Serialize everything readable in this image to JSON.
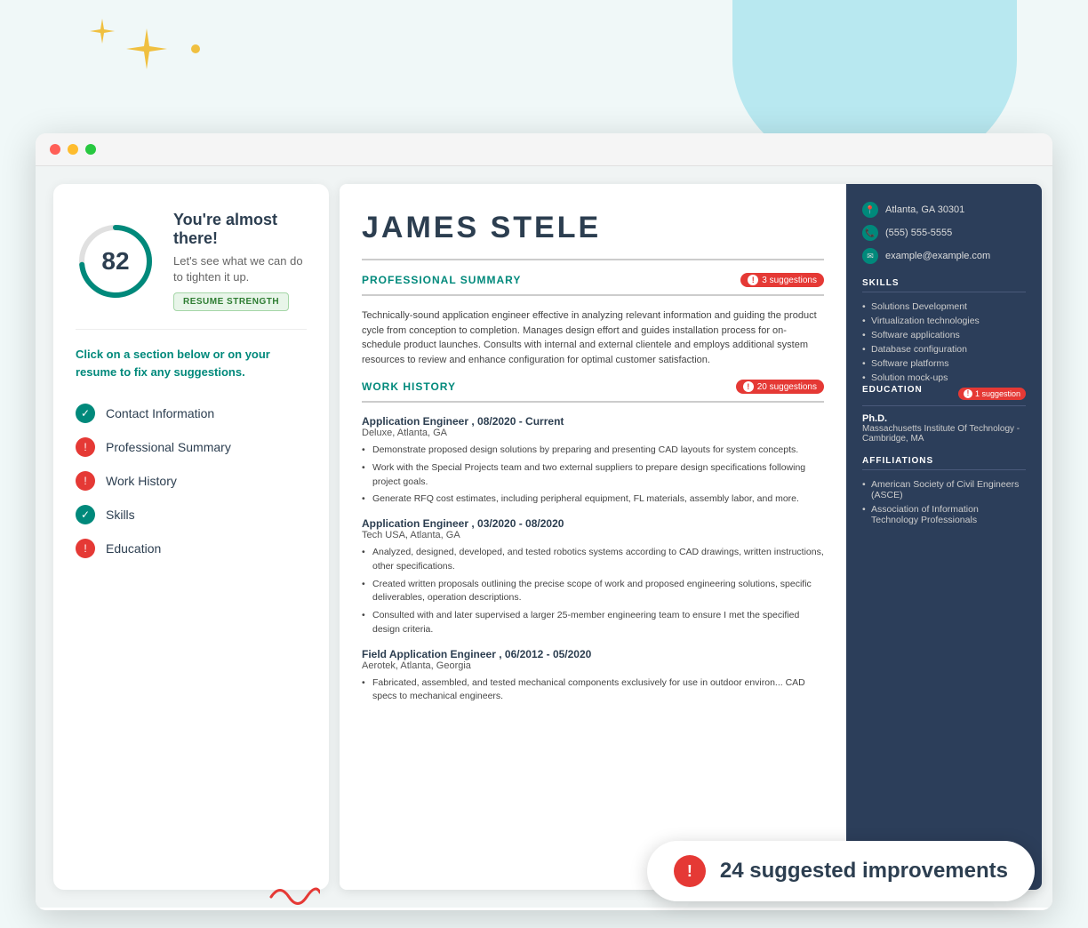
{
  "decorations": {
    "blob_color": "#b8dfe8",
    "sparkle_color": "#f0c040"
  },
  "browser": {
    "dots": [
      "#ff5f57",
      "#febc2e",
      "#28c840"
    ]
  },
  "score_panel": {
    "score": "82",
    "heading": "You're almost there!",
    "subtext": "Let's see what we can do to tighten it up.",
    "badge": "RESUME STRENGTH",
    "instruction": "Click on a section below or on your resume to fix any suggestions.",
    "checklist": [
      {
        "label": "Contact Information",
        "status": "ok"
      },
      {
        "label": "Professional Summary",
        "status": "warn"
      },
      {
        "label": "Work History",
        "status": "warn"
      },
      {
        "label": "Skills",
        "status": "ok"
      },
      {
        "label": "Education",
        "status": "warn"
      }
    ]
  },
  "resume": {
    "name": "JAMES  STELE",
    "sections": {
      "professional_summary": {
        "title": "PROFESSIONAL SUMMARY",
        "suggestions": "3 suggestions",
        "text": "Technically-sound application engineer effective in analyzing relevant information and guiding the product cycle from conception to completion. Manages design effort and guides installation process for on-schedule product launches. Consults with internal and external clientele and employs additional system resources to review and enhance configuration for optimal customer satisfaction."
      },
      "work_history": {
        "title": "WORK HISTORY",
        "suggestions": "20 suggestions",
        "jobs": [
          {
            "title": "Application Engineer",
            "dates": "08/2020 - Current",
            "company": "Deluxe, Atlanta, GA",
            "bullets": [
              "Demonstrate proposed design solutions by preparing and presenting CAD layouts for system concepts.",
              "Work with the Special Projects team and two external suppliers to prepare design specifications following project goals.",
              "Generate RFQ cost estimates, including peripheral equipment, FL materials, assembly labor, and more."
            ]
          },
          {
            "title": "Application Engineer",
            "dates": "03/2020 - 08/2020",
            "company": "Tech USA, Atlanta, GA",
            "bullets": [
              "Analyzed, designed, developed, and tested robotics systems according to CAD drawings, written instructions, other specifications.",
              "Created written proposals outlining the precise scope of work and proposed engineering solutions, specific deliverables, operation descriptions.",
              "Consulted with and later supervised a larger 25-member engineering team to ensure I met the specified design criteria."
            ]
          },
          {
            "title": "Field Application Engineer",
            "dates": "06/2012 - 05/2020",
            "company": "Aerotek, Atlanta, Georgia",
            "bullets": [
              "Fabricated, assembled, and tested mechanical components exclusively for use in outdoor environ... CAD specs to mechanical engineers."
            ]
          }
        ]
      }
    },
    "sidebar": {
      "location": "Atlanta, GA 30301",
      "phone": "(555) 555-5555",
      "email": "example@example.com",
      "skills_title": "SKILLS",
      "skills": [
        "Solutions Development",
        "Virtualization technologies",
        "Software applications",
        "Database configuration",
        "Software platforms",
        "Solution mock-ups"
      ],
      "education_title": "EDUCATION",
      "education_suggestion": "1 suggestion",
      "degree": "Ph.D.",
      "school": "Massachusetts Institute Of Technology - Cambridge, MA",
      "affiliations_title": "AFFILIATIONS",
      "affiliations": [
        "American Society of Civil Engineers (ASCE)",
        "Association of Information Technology Professionals"
      ]
    }
  },
  "banner": {
    "text": "24 suggested improvements"
  }
}
